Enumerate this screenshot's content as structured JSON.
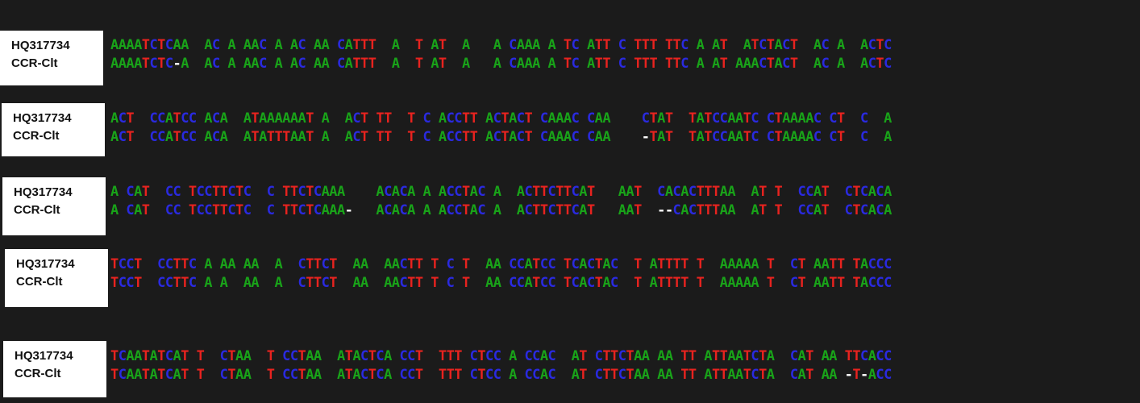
{
  "colors": {
    "A": "#19a319",
    "T": "#e8231f",
    "C": "#2a2adf",
    "G": "#e8a020",
    "-": "#ffffff",
    "background": "#1b1b1b"
  },
  "blocks": [
    {
      "labels": [
        "HQ317734",
        "CCR-Clt"
      ],
      "seqs": [
        "AAAATCTCAA  AC A AAC A AC AA CATTT  A  T AT  A   A CAAA A TC ATT C TTT TTC A AT  ATCTACT  AC A  ACTC",
        "AAAATCTC-A  AC A AAC A AC AA CATTT  A  T AT  A   A CAAA A TC ATT C TTT TTC A AT AAACTACT  AC A  ACTC"
      ]
    },
    {
      "labels": [
        "HQ317734",
        "CCR-Clt"
      ],
      "seqs": [
        "ACT  CCATCC ACA  ATAAAAAAT A  ACT TT  T C ACCTT ACTACT CAAAC CAA    CTAT  TATCCAATC CTAAAAC CT  C  A",
        "ACT  CCATCC ACA  ATATTTAAT A  ACT TT  T C ACCTT ACTACT CAAAC CAA    -TAT  TATCCAATC CTAAAAC CT  C  A"
      ]
    },
    {
      "labels": [
        "HQ317734",
        "CCR-Clt"
      ],
      "seqs": [
        "A CAT  CC TCCTTCTC  C TTCTCAAA    ACACA A ACCTAC A  ACTTCTTCAT   AAT  CACACTTTAA  AT T  CCAT  CTCACA",
        "A CAT  CC TCCTTCTC  C TTCTCAAA-   ACACA A ACCTAC A  ACTTCTTCAT   AAT  --CACTTTAA  AT T  CCAT  CTCACA"
      ]
    },
    {
      "labels": [
        "HQ317734",
        "CCR-Clt"
      ],
      "seqs": [
        "TCCT  CCTTC A AA AA  A  CTTCT  AA  AACTT T C T  AA CCATCC TCACTAC  T ATTTT T  AAAAA T  CT AATT TACCC",
        "TCCT  CCTTC A A  AA  A  CTTCT  AA  AACTT T C T  AA CCATCC TCACTAC  T ATTTT T  AAAAA T  CT AATT TACCC"
      ]
    },
    {
      "labels": [
        "HQ317734",
        "CCR-Clt"
      ],
      "seqs": [
        "TCAATATCAT T  CTAA  T CCTAA  ATACTCA CCT  TTT CTCC A CCAC  AT CTTCTAA AA TT ATTAATCTA  CAT AA TTCACC",
        "TCAATATCAT T  CTAA  T CCTAA  ATACTCA CCT  TTT CTCC A CCAC  AT CTTCTAA AA TT ATTAATCTA  CAT AA -T-ACC"
      ]
    }
  ]
}
